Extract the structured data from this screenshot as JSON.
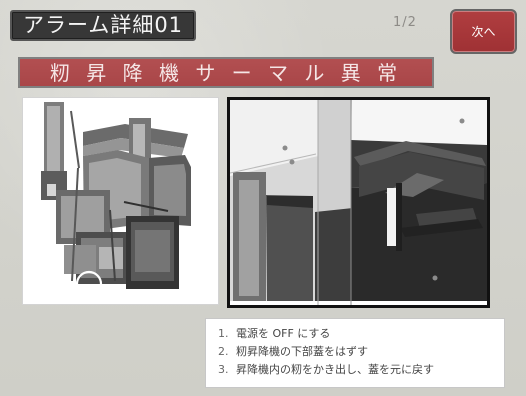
{
  "header": {
    "title": "アラーム詳細01",
    "page_indicator": "1/2",
    "next_button_label": "次へ"
  },
  "alarm": {
    "name": "籾 昇 降 機 サ ー マ ル 異 常"
  },
  "images": {
    "left_icon": "machine-overview-icon",
    "right_icon": "elevator-detail-icon"
  },
  "instructions": [
    {
      "number": "1.",
      "text": "電源を OFF にする"
    },
    {
      "number": "2.",
      "text": "籾昇降機の下部蓋をはずす"
    },
    {
      "number": "3.",
      "text": "昇降機内の籾をかき出し、蓋を元に戻す"
    }
  ],
  "colors": {
    "title_background": "#373737",
    "alarm_red": "#a94648",
    "button_red": "#9f3134",
    "screen_gray": "#d6d6d0"
  }
}
